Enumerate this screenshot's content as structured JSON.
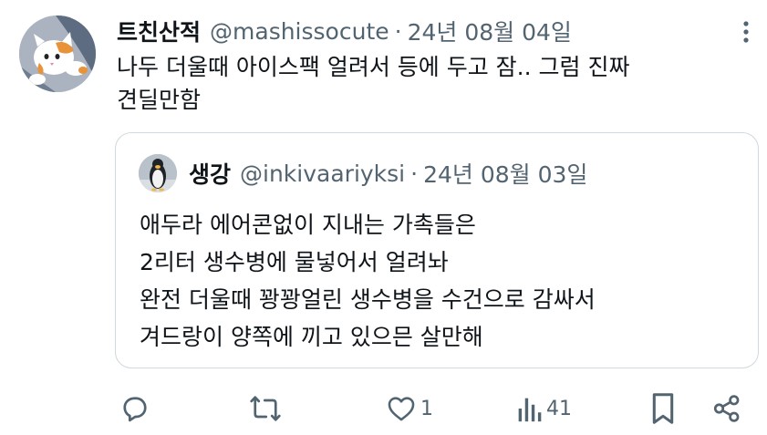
{
  "tweet": {
    "display_name": "트친산적",
    "handle": "@mashissocute",
    "separator": "·",
    "date": "24년 08월 04일",
    "text_line1": "나두 더울때 아이스팩 얼려서 등에 두고 잠.. 그럼 진짜",
    "text_line2": "견딜만함",
    "avatar_icon": "cat-avatar-icon",
    "more_icon": "more-vertical-icon"
  },
  "quote": {
    "display_name": "생강",
    "handle": "@inkivaariyksi",
    "separator": "·",
    "date": "24년 08월 03일",
    "avatar_icon": "penguin-avatar-icon",
    "lines": [
      "애두라 에어콘없이 지내는 가촉들은",
      "2리터 생수병에 물넣어서 얼려놔",
      "완전 더울때 꽝꽝얼린 생수병을 수건으로 감싸서",
      "겨드랑이 양쪽에 끼고 있으믄 살만해"
    ]
  },
  "actions": {
    "reply_icon": "reply-icon",
    "retweet_icon": "retweet-icon",
    "like_icon": "heart-icon",
    "like_count": "1",
    "views_icon": "views-icon",
    "views_count": "41",
    "bookmark_icon": "bookmark-icon",
    "share_icon": "share-icon"
  },
  "colors": {
    "text": "#0f1419",
    "muted": "#536471",
    "border": "#cfd9de"
  }
}
